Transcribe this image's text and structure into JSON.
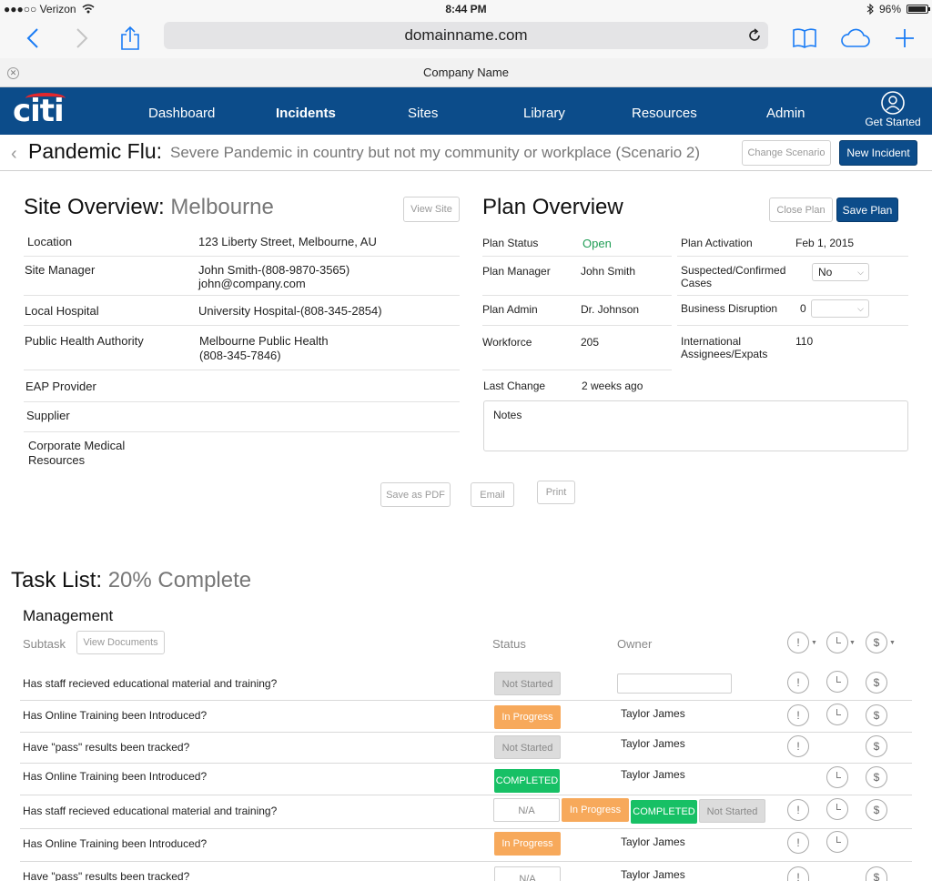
{
  "status_bar": {
    "carrier": "●●●○○ Verizon",
    "time": "8:44 PM",
    "battery": "96%",
    "battery_fraction": 0.96
  },
  "browser": {
    "url": "domainname.com",
    "tab_title": "Company Name",
    "icons": [
      "back-icon",
      "forward-icon",
      "share-icon",
      "reload-icon",
      "bookmarks-icon",
      "cloud-icon",
      "add-tab-icon"
    ]
  },
  "nav": {
    "logo": "citi",
    "items": [
      "Dashboard",
      "Incidents",
      "Sites",
      "Library",
      "Resources",
      "Admin"
    ],
    "active": "Incidents",
    "get_started": "Get Started"
  },
  "page_header": {
    "title": "Pandemic Flu:",
    "subtitle": "Severe Pandemic in country but not my community or workplace (Scenario  2)",
    "change_scenario": "Change Scenario",
    "new_incident": "New Incident"
  },
  "site_overview": {
    "title": "Site Overview:",
    "site": "Melbourne",
    "view_site": "View Site",
    "fields": [
      {
        "label": "Location",
        "value": "123 Liberty Street, Melbourne, AU"
      },
      {
        "label": "Site Manager",
        "value": "John Smith-(808-9870-3565)",
        "value2": "john@company.com"
      },
      {
        "label": "Local Hospital",
        "value": "University Hospital-(808-345-2854)"
      },
      {
        "label": "Public Health Authority",
        "value": "Melbourne Public Health",
        "value2": "(808-345-7846)"
      },
      {
        "label": "EAP Provider",
        "value": ""
      },
      {
        "label": "Supplier",
        "value": ""
      },
      {
        "label": "Corporate Medical",
        "label2": "Resources",
        "value": ""
      }
    ]
  },
  "plan_overview": {
    "title": "Plan Overview",
    "close_plan": "Close Plan",
    "save_plan": "Save Plan",
    "left": [
      {
        "label": "Plan Status",
        "value": "Open"
      },
      {
        "label": "Plan Manager",
        "value": "John Smith"
      },
      {
        "label": "Plan Admin",
        "value": "Dr. Johnson"
      },
      {
        "label": "Workforce",
        "value": "205"
      },
      {
        "label": "Last Change",
        "value": "2 weeks ago"
      }
    ],
    "right": [
      {
        "label": "Plan Activation",
        "value": "Feb 1, 2015"
      },
      {
        "label": "Suspected/Confirmed",
        "label2": "Cases",
        "value": "No"
      },
      {
        "label": "Business Disruption",
        "value": "0"
      },
      {
        "label": "International",
        "label2": "Assignees/Expats",
        "value": "110"
      }
    ],
    "notes_label": "Notes"
  },
  "actions": {
    "save_pdf": "Save as PDF",
    "email": "Email",
    "print": "Print"
  },
  "task_list": {
    "title": "Task List:",
    "progress": "20% Complete",
    "section": "Management",
    "col_subtask": "Subtask",
    "view_documents": "View Documents",
    "col_status": "Status",
    "col_owner": "Owner",
    "rows": [
      {
        "task": "Has staff recieved educational material and training?",
        "status": "Not Started",
        "owner": ""
      },
      {
        "task": "Has Online Training been Introduced?",
        "status": "In Progress",
        "owner": "Taylor James"
      },
      {
        "task": "Have \"pass\" results been tracked?",
        "status": "Not Started",
        "owner": "Taylor James"
      },
      {
        "task": "Has Online Training been Introduced?",
        "status": "COMPLETED",
        "owner": "Taylor James"
      },
      {
        "task": "Has staff recieved educational material and training?",
        "status": "N/A",
        "owner": "",
        "options": [
          "In Progress",
          "COMPLETED",
          "Not Started"
        ]
      },
      {
        "task": "Has Online Training been Introduced?",
        "status": "In Progress",
        "owner": "Taylor James"
      },
      {
        "task": "Have \"pass\" results been tracked?",
        "status": "N/A",
        "owner": "Taylor James"
      }
    ]
  }
}
